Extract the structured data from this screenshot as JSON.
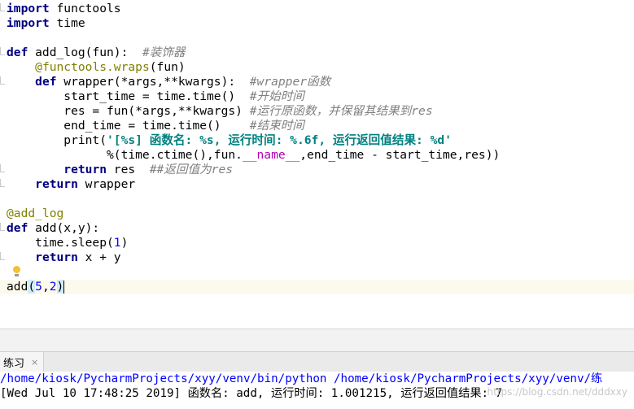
{
  "editor": {
    "lines": [
      {
        "t": [
          {
            "c": "kw",
            "v": "import"
          },
          {
            "c": "",
            "v": " functools"
          }
        ]
      },
      {
        "t": [
          {
            "c": "kw",
            "v": "import"
          },
          {
            "c": "",
            "v": " time"
          }
        ]
      },
      {
        "t": []
      },
      {
        "t": [
          {
            "c": "kw",
            "v": "def"
          },
          {
            "c": "",
            "v": " add_log(fun):  "
          },
          {
            "c": "cmt",
            "v": "#装饰器"
          }
        ]
      },
      {
        "t": [
          {
            "c": "",
            "v": "    "
          },
          {
            "c": "deco",
            "v": "@functools.wraps"
          },
          {
            "c": "",
            "v": "(fun)"
          }
        ]
      },
      {
        "t": [
          {
            "c": "",
            "v": "    "
          },
          {
            "c": "kw",
            "v": "def"
          },
          {
            "c": "",
            "v": " wrapper(*args,**kwargs):  "
          },
          {
            "c": "cmt",
            "v": "#wrapper函数"
          }
        ]
      },
      {
        "t": [
          {
            "c": "",
            "v": "        start_time = time.time()  "
          },
          {
            "c": "cmt",
            "v": "#开始时间"
          }
        ]
      },
      {
        "t": [
          {
            "c": "",
            "v": "        res = fun(*args,**kwargs) "
          },
          {
            "c": "cmt",
            "v": "#运行原函数，并保留其结果到res"
          }
        ]
      },
      {
        "t": [
          {
            "c": "",
            "v": "        end_time = time.time()    "
          },
          {
            "c": "cmt",
            "v": "#结束时间"
          }
        ]
      },
      {
        "t": [
          {
            "c": "",
            "v": "        print("
          },
          {
            "c": "str",
            "v": "'[%s] 函数名: %s, 运行时间: %.6f, 运行返回值结果: %d'"
          }
        ]
      },
      {
        "t": [
          {
            "c": "",
            "v": "              %(time.ctime(),fun."
          },
          {
            "c": "magic",
            "v": "__name__"
          },
          {
            "c": "",
            "v": ",end_time - start_time,res))"
          }
        ]
      },
      {
        "t": [
          {
            "c": "",
            "v": "        "
          },
          {
            "c": "kw",
            "v": "return"
          },
          {
            "c": "",
            "v": " res  "
          },
          {
            "c": "cmt",
            "v": "##返回值为res"
          }
        ]
      },
      {
        "t": [
          {
            "c": "",
            "v": "    "
          },
          {
            "c": "kw",
            "v": "return"
          },
          {
            "c": "",
            "v": " wrapper"
          }
        ]
      },
      {
        "t": []
      },
      {
        "t": [
          {
            "c": "deco",
            "v": "@add_log"
          }
        ]
      },
      {
        "t": [
          {
            "c": "kw",
            "v": "def"
          },
          {
            "c": "",
            "v": " add(x,y):"
          }
        ]
      },
      {
        "t": [
          {
            "c": "",
            "v": "    time.sleep("
          },
          {
            "c": "num",
            "v": "1"
          },
          {
            "c": "",
            "v": ")"
          }
        ]
      },
      {
        "t": [
          {
            "c": "",
            "v": "    "
          },
          {
            "c": "kw",
            "v": "return"
          },
          {
            "c": "",
            "v": " x + y"
          }
        ]
      },
      {
        "t": []
      },
      {
        "current": true,
        "t": [
          {
            "c": "",
            "v": "add"
          },
          {
            "c": "match",
            "v": "("
          },
          {
            "c": "num",
            "v": "5"
          },
          {
            "c": "",
            "v": ","
          },
          {
            "c": "num",
            "v": "2"
          },
          {
            "c": "match",
            "v": ")"
          }
        ]
      }
    ]
  },
  "run_panel": {
    "tab_label": "练习",
    "close_glyph": "×",
    "console_lines": [
      {
        "kind": "path",
        "text": "/home/kiosk/PycharmProjects/xyy/venv/bin/python /home/kiosk/PycharmProjects/xyy/venv/练"
      },
      {
        "kind": "out",
        "text": "[Wed Jul 10 17:48:25 2019] 函数名: add, 运行时间: 1.001215, 运行返回值结果: 7"
      }
    ]
  },
  "watermark": "https://blog.csdn.net/dddxxy",
  "colors": {
    "keyword": "#000080",
    "decorator": "#808000",
    "number": "#0000ff",
    "string": "#008080",
    "comment": "#808080",
    "magic": "#b200b2",
    "current_line": "#fcfaed",
    "console_path": "#0000ff"
  },
  "icons": {
    "intention_bulb": "lightbulb-icon",
    "tab_close": "close-icon"
  }
}
